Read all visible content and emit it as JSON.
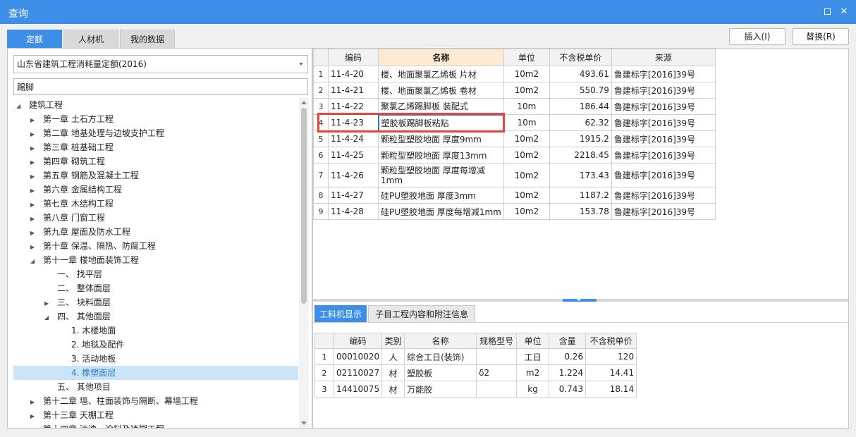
{
  "window": {
    "title": "查询",
    "close_glyph": "✕"
  },
  "tabs": [
    {
      "label": "定额",
      "active": true
    },
    {
      "label": "人材机",
      "active": false
    },
    {
      "label": "我的数据",
      "active": false
    }
  ],
  "toolbar": {
    "insert_label": "插入(I)",
    "replace_label": "替换(R)"
  },
  "left": {
    "quota_selected": "山东省建筑工程消耗量定额(2016)",
    "search_value": "踢脚",
    "tree": [
      {
        "label": "建筑工程",
        "level": 0,
        "arrow": "◢"
      },
      {
        "label": "第一章 土石方工程",
        "level": 1,
        "arrow": "▶"
      },
      {
        "label": "第二章 地基处理与边坡支护工程",
        "level": 1,
        "arrow": "▶"
      },
      {
        "label": "第三章 桩基础工程",
        "level": 1,
        "arrow": "▶"
      },
      {
        "label": "第四章 砌筑工程",
        "level": 1,
        "arrow": "▶"
      },
      {
        "label": "第五章 钢筋及混凝土工程",
        "level": 1,
        "arrow": "▶"
      },
      {
        "label": "第六章 金属结构工程",
        "level": 1,
        "arrow": "▶"
      },
      {
        "label": "第七章 木结构工程",
        "level": 1,
        "arrow": "▶"
      },
      {
        "label": "第八章 门窗工程",
        "level": 1,
        "arrow": "▶"
      },
      {
        "label": "第九章 屋面及防水工程",
        "level": 1,
        "arrow": "▶"
      },
      {
        "label": "第十章 保温、隔热、防腐工程",
        "level": 1,
        "arrow": "▶"
      },
      {
        "label": "第十一章 楼地面装饰工程",
        "level": 1,
        "arrow": "◢"
      },
      {
        "label": "一、 找平层",
        "level": 2,
        "arrow": ""
      },
      {
        "label": "二、 整体面层",
        "level": 2,
        "arrow": ""
      },
      {
        "label": "三、 块料面层",
        "level": 2,
        "arrow": "▶"
      },
      {
        "label": "四、 其他面层",
        "level": 2,
        "arrow": "◢"
      },
      {
        "label": "1. 木楼地面",
        "level": 3,
        "arrow": ""
      },
      {
        "label": "2. 地毯及配件",
        "level": 3,
        "arrow": ""
      },
      {
        "label": "3. 活动地板",
        "level": 3,
        "arrow": ""
      },
      {
        "label": "4. 橡塑面层",
        "level": 3,
        "arrow": "",
        "selected": true
      },
      {
        "label": "五、 其他项目",
        "level": 2,
        "arrow": ""
      },
      {
        "label": "第十二章 墙、柱面装饰与隔断、幕墙工程",
        "level": 1,
        "arrow": "▶"
      },
      {
        "label": "第十三章 天棚工程",
        "level": 1,
        "arrow": "▶"
      },
      {
        "label": "第十四章 油漆、涂料及裱糊工程",
        "level": 1,
        "arrow": "▶"
      }
    ]
  },
  "main_table": {
    "columns": [
      "",
      "编码",
      "名称",
      "单位",
      "不含税单价",
      "来源"
    ],
    "rows": [
      {
        "idx": "1",
        "code": "11-4-20",
        "name": "楼、地面聚氯乙烯板 片材",
        "unit": "10m2",
        "price": "493.61",
        "source": "鲁建标字[2016]39号"
      },
      {
        "idx": "2",
        "code": "11-4-21",
        "name": "楼、地面聚氯乙烯板 卷材",
        "unit": "10m2",
        "price": "550.79",
        "source": "鲁建标字[2016]39号"
      },
      {
        "idx": "3",
        "code": "11-4-22",
        "name": "聚氯乙烯踢脚板 装配式",
        "unit": "10m",
        "price": "186.44",
        "source": "鲁建标字[2016]39号"
      },
      {
        "idx": "4",
        "code": "11-4-23",
        "name": "塑胶板踢脚板粘贴",
        "unit": "10m",
        "price": "62.32",
        "source": "鲁建标字[2016]39号"
      },
      {
        "idx": "5",
        "code": "11-4-24",
        "name": "颗粒型塑胶地面 厚度9mm",
        "unit": "10m2",
        "price": "1915.2",
        "source": "鲁建标字[2016]39号"
      },
      {
        "idx": "6",
        "code": "11-4-25",
        "name": "颗粒型塑胶地面 厚度13mm",
        "unit": "10m2",
        "price": "2218.45",
        "source": "鲁建标字[2016]39号"
      },
      {
        "idx": "7",
        "code": "11-4-26",
        "name": "颗粒型塑胶地面 厚度每增减1mm",
        "unit": "10m2",
        "price": "173.43",
        "source": "鲁建标字[2016]39号"
      },
      {
        "idx": "8",
        "code": "11-4-27",
        "name": "硅PU塑胶地面 厚度3mm",
        "unit": "10m2",
        "price": "1187.2",
        "source": "鲁建标字[2016]39号"
      },
      {
        "idx": "9",
        "code": "11-4-28",
        "name": "硅PU塑胶地面 厚度每增减1mm",
        "unit": "10m2",
        "price": "153.78",
        "source": "鲁建标字[2016]39号"
      }
    ]
  },
  "bottom_tabs": [
    {
      "label": "工料机显示",
      "active": true
    },
    {
      "label": "子目工程内容和附注信息",
      "active": false
    }
  ],
  "sub_table": {
    "columns": [
      "",
      "编码",
      "类别",
      "名称",
      "规格型号",
      "单位",
      "含量",
      "不含税单价"
    ],
    "rows": [
      {
        "idx": "1",
        "code": "00010020",
        "type": "人",
        "name": "综合工日(装饰)",
        "spec": "",
        "unit": "工日",
        "qty": "0.26",
        "price": "120"
      },
      {
        "idx": "2",
        "code": "02110027",
        "type": "材",
        "name": "塑胶板",
        "spec": "δ2",
        "unit": "m2",
        "qty": "1.224",
        "price": "14.41"
      },
      {
        "idx": "3",
        "code": "14410075",
        "type": "材",
        "name": "万能胶",
        "spec": "",
        "unit": "kg",
        "qty": "0.743",
        "price": "18.14"
      }
    ]
  }
}
